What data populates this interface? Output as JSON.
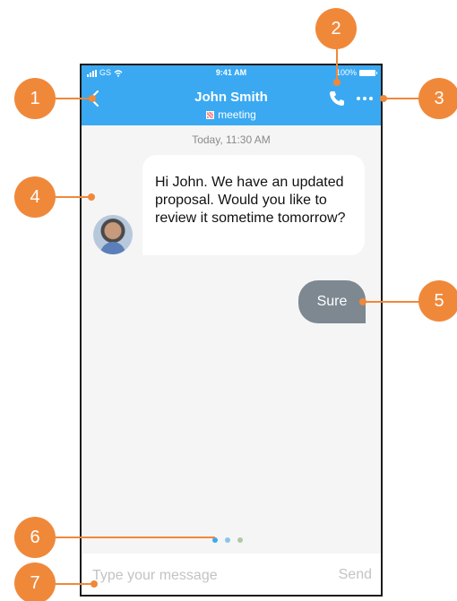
{
  "status_bar": {
    "carrier": "GS",
    "time": "9:41 AM",
    "battery": "100%"
  },
  "header": {
    "contact_name": "John Smith",
    "tag": "meeting",
    "icons": {
      "back": "chevron-left-icon",
      "call": "phone-icon",
      "more": "ellipsis-icon"
    }
  },
  "chat": {
    "date_separator": "Today, 11:30 AM",
    "messages": [
      {
        "direction": "incoming",
        "text": "Hi John. We have an updated proposal. Would you like to review it sometime tomorrow?"
      },
      {
        "direction": "outgoing",
        "text": "Sure"
      }
    ],
    "typing_dot_colors": [
      "#3aa9f2",
      "#8ec4ea",
      "#b3c7a8"
    ]
  },
  "composer": {
    "placeholder": "Type your message",
    "send_label": "Send"
  },
  "callouts": [
    "1",
    "2",
    "3",
    "4",
    "5",
    "6",
    "7"
  ],
  "colors": {
    "header": "#3aa9f2",
    "callout": "#f0883a",
    "outgoing_bubble": "#7d8891"
  }
}
